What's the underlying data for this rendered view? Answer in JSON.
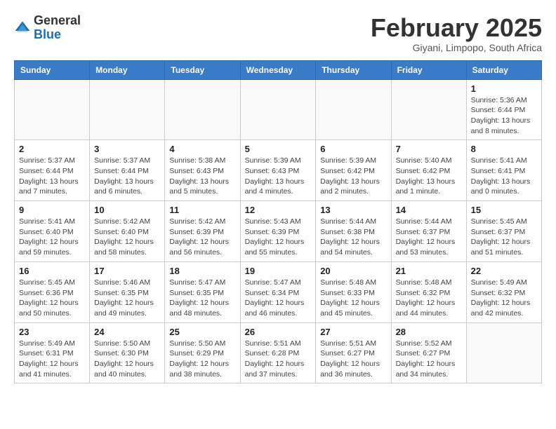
{
  "header": {
    "logo_general": "General",
    "logo_blue": "Blue",
    "title": "February 2025",
    "subtitle": "Giyani, Limpopo, South Africa"
  },
  "columns": [
    "Sunday",
    "Monday",
    "Tuesday",
    "Wednesday",
    "Thursday",
    "Friday",
    "Saturday"
  ],
  "weeks": [
    [
      {
        "day": "",
        "info": ""
      },
      {
        "day": "",
        "info": ""
      },
      {
        "day": "",
        "info": ""
      },
      {
        "day": "",
        "info": ""
      },
      {
        "day": "",
        "info": ""
      },
      {
        "day": "",
        "info": ""
      },
      {
        "day": "1",
        "info": "Sunrise: 5:36 AM\nSunset: 6:44 PM\nDaylight: 13 hours and 8 minutes."
      }
    ],
    [
      {
        "day": "2",
        "info": "Sunrise: 5:37 AM\nSunset: 6:44 PM\nDaylight: 13 hours and 7 minutes."
      },
      {
        "day": "3",
        "info": "Sunrise: 5:37 AM\nSunset: 6:44 PM\nDaylight: 13 hours and 6 minutes."
      },
      {
        "day": "4",
        "info": "Sunrise: 5:38 AM\nSunset: 6:43 PM\nDaylight: 13 hours and 5 minutes."
      },
      {
        "day": "5",
        "info": "Sunrise: 5:39 AM\nSunset: 6:43 PM\nDaylight: 13 hours and 4 minutes."
      },
      {
        "day": "6",
        "info": "Sunrise: 5:39 AM\nSunset: 6:42 PM\nDaylight: 13 hours and 2 minutes."
      },
      {
        "day": "7",
        "info": "Sunrise: 5:40 AM\nSunset: 6:42 PM\nDaylight: 13 hours and 1 minute."
      },
      {
        "day": "8",
        "info": "Sunrise: 5:41 AM\nSunset: 6:41 PM\nDaylight: 13 hours and 0 minutes."
      }
    ],
    [
      {
        "day": "9",
        "info": "Sunrise: 5:41 AM\nSunset: 6:40 PM\nDaylight: 12 hours and 59 minutes."
      },
      {
        "day": "10",
        "info": "Sunrise: 5:42 AM\nSunset: 6:40 PM\nDaylight: 12 hours and 58 minutes."
      },
      {
        "day": "11",
        "info": "Sunrise: 5:42 AM\nSunset: 6:39 PM\nDaylight: 12 hours and 56 minutes."
      },
      {
        "day": "12",
        "info": "Sunrise: 5:43 AM\nSunset: 6:39 PM\nDaylight: 12 hours and 55 minutes."
      },
      {
        "day": "13",
        "info": "Sunrise: 5:44 AM\nSunset: 6:38 PM\nDaylight: 12 hours and 54 minutes."
      },
      {
        "day": "14",
        "info": "Sunrise: 5:44 AM\nSunset: 6:37 PM\nDaylight: 12 hours and 53 minutes."
      },
      {
        "day": "15",
        "info": "Sunrise: 5:45 AM\nSunset: 6:37 PM\nDaylight: 12 hours and 51 minutes."
      }
    ],
    [
      {
        "day": "16",
        "info": "Sunrise: 5:45 AM\nSunset: 6:36 PM\nDaylight: 12 hours and 50 minutes."
      },
      {
        "day": "17",
        "info": "Sunrise: 5:46 AM\nSunset: 6:35 PM\nDaylight: 12 hours and 49 minutes."
      },
      {
        "day": "18",
        "info": "Sunrise: 5:47 AM\nSunset: 6:35 PM\nDaylight: 12 hours and 48 minutes."
      },
      {
        "day": "19",
        "info": "Sunrise: 5:47 AM\nSunset: 6:34 PM\nDaylight: 12 hours and 46 minutes."
      },
      {
        "day": "20",
        "info": "Sunrise: 5:48 AM\nSunset: 6:33 PM\nDaylight: 12 hours and 45 minutes."
      },
      {
        "day": "21",
        "info": "Sunrise: 5:48 AM\nSunset: 6:32 PM\nDaylight: 12 hours and 44 minutes."
      },
      {
        "day": "22",
        "info": "Sunrise: 5:49 AM\nSunset: 6:32 PM\nDaylight: 12 hours and 42 minutes."
      }
    ],
    [
      {
        "day": "23",
        "info": "Sunrise: 5:49 AM\nSunset: 6:31 PM\nDaylight: 12 hours and 41 minutes."
      },
      {
        "day": "24",
        "info": "Sunrise: 5:50 AM\nSunset: 6:30 PM\nDaylight: 12 hours and 40 minutes."
      },
      {
        "day": "25",
        "info": "Sunrise: 5:50 AM\nSunset: 6:29 PM\nDaylight: 12 hours and 38 minutes."
      },
      {
        "day": "26",
        "info": "Sunrise: 5:51 AM\nSunset: 6:28 PM\nDaylight: 12 hours and 37 minutes."
      },
      {
        "day": "27",
        "info": "Sunrise: 5:51 AM\nSunset: 6:27 PM\nDaylight: 12 hours and 36 minutes."
      },
      {
        "day": "28",
        "info": "Sunrise: 5:52 AM\nSunset: 6:27 PM\nDaylight: 12 hours and 34 minutes."
      },
      {
        "day": "",
        "info": ""
      }
    ]
  ]
}
